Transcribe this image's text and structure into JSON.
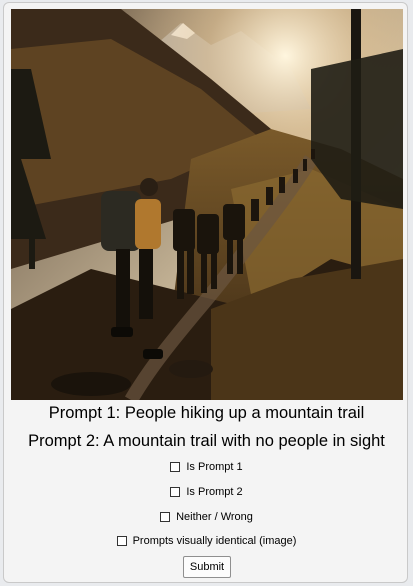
{
  "image": {
    "alt_subject": "hikers-mountain-trail-photo"
  },
  "prompts": {
    "prompt1": "Prompt 1: People hiking up a mountain trail",
    "prompt2": "Prompt 2: A mountain trail with no people in sight"
  },
  "options": [
    {
      "label": "Is Prompt 1",
      "checked": false
    },
    {
      "label": "Is Prompt 2",
      "checked": false
    },
    {
      "label": "Neither / Wrong",
      "checked": false
    },
    {
      "label": "Prompts visually identical (image)",
      "checked": false
    }
  ],
  "submit_label": "Submit",
  "colors": {
    "page_bg": "#e9ebee",
    "card_bg": "#f4f4f4"
  }
}
